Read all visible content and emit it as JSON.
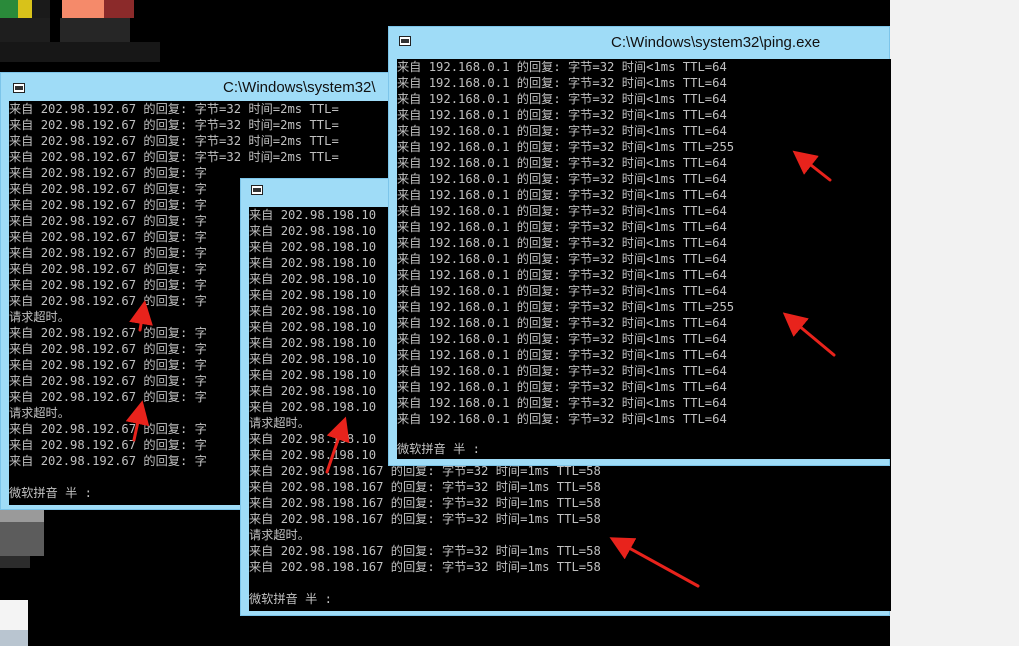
{
  "windows": {
    "left": {
      "title": "C:\\Windows\\system32\\",
      "lines": [
        "来自 202.98.192.67 的回复: 字节=32 时间=2ms TTL=",
        "来自 202.98.192.67 的回复: 字节=32 时间=2ms TTL=",
        "来自 202.98.192.67 的回复: 字节=32 时间=2ms TTL=",
        "来自 202.98.192.67 的回复: 字节=32 时间=2ms TTL=",
        "来自 202.98.192.67 的回复: 字",
        "来自 202.98.192.67 的回复: 字",
        "来自 202.98.192.67 的回复: 字",
        "来自 202.98.192.67 的回复: 字",
        "来自 202.98.192.67 的回复: 字",
        "来自 202.98.192.67 的回复: 字",
        "来自 202.98.192.67 的回复: 字",
        "来自 202.98.192.67 的回复: 字",
        "来自 202.98.192.67 的回复: 字",
        "请求超时。",
        "来自 202.98.192.67 的回复: 字",
        "来自 202.98.192.67 的回复: 字",
        "来自 202.98.192.67 的回复: 字",
        "来自 202.98.192.67 的回复: 字",
        "来自 202.98.192.67 的回复: 字",
        "请求超时。",
        "来自 202.98.192.67 的回复: 字",
        "来自 202.98.192.67 的回复: 字",
        "来自 202.98.192.67 的回复: 字"
      ],
      "ime": "微软拼音 半 :"
    },
    "middle": {
      "lines": [
        "来自 202.98.198.10",
        "来自 202.98.198.10",
        "来自 202.98.198.10",
        "来自 202.98.198.10",
        "来自 202.98.198.10",
        "来自 202.98.198.10",
        "来自 202.98.198.10",
        "来自 202.98.198.10",
        "来自 202.98.198.10",
        "来自 202.98.198.10",
        "来自 202.98.198.10",
        "来自 202.98.198.10",
        "来自 202.98.198.10",
        "请求超时。",
        "来自 202.98.198.10",
        "来自 202.98.198.10",
        "来自 202.98.198.167 的回复: 字节=32 时间=1ms TTL=58",
        "来自 202.98.198.167 的回复: 字节=32 时间=1ms TTL=58",
        "来自 202.98.198.167 的回复: 字节=32 时间=1ms TTL=58",
        "来自 202.98.198.167 的回复: 字节=32 时间=1ms TTL=58",
        "请求超时。",
        "来自 202.98.198.167 的回复: 字节=32 时间=1ms TTL=58",
        "来自 202.98.198.167 的回复: 字节=32 时间=1ms TTL=58"
      ],
      "ime": "微软拼音 半 :"
    },
    "right": {
      "title": "C:\\Windows\\system32\\ping.exe",
      "lines": [
        "来自 192.168.0.1 的回复: 字节=32 时间<1ms TTL=64",
        "来自 192.168.0.1 的回复: 字节=32 时间<1ms TTL=64",
        "来自 192.168.0.1 的回复: 字节=32 时间<1ms TTL=64",
        "来自 192.168.0.1 的回复: 字节=32 时间<1ms TTL=64",
        "来自 192.168.0.1 的回复: 字节=32 时间<1ms TTL=64",
        "来自 192.168.0.1 的回复: 字节=32 时间<1ms TTL=255",
        "来自 192.168.0.1 的回复: 字节=32 时间<1ms TTL=64",
        "来自 192.168.0.1 的回复: 字节=32 时间<1ms TTL=64",
        "来自 192.168.0.1 的回复: 字节=32 时间<1ms TTL=64",
        "来自 192.168.0.1 的回复: 字节=32 时间<1ms TTL=64",
        "来自 192.168.0.1 的回复: 字节=32 时间<1ms TTL=64",
        "来自 192.168.0.1 的回复: 字节=32 时间<1ms TTL=64",
        "来自 192.168.0.1 的回复: 字节=32 时间<1ms TTL=64",
        "来自 192.168.0.1 的回复: 字节=32 时间<1ms TTL=64",
        "来自 192.168.0.1 的回复: 字节=32 时间<1ms TTL=64",
        "来自 192.168.0.1 的回复: 字节=32 时间<1ms TTL=255",
        "来自 192.168.0.1 的回复: 字节=32 时间<1ms TTL=64",
        "来自 192.168.0.1 的回复: 字节=32 时间<1ms TTL=64",
        "来自 192.168.0.1 的回复: 字节=32 时间<1ms TTL=64",
        "来自 192.168.0.1 的回复: 字节=32 时间<1ms TTL=64",
        "来自 192.168.0.1 的回复: 字节=32 时间<1ms TTL=64",
        "来自 192.168.0.1 的回复: 字节=32 时间<1ms TTL=64",
        "来自 192.168.0.1 的回复: 字节=32 时间<1ms TTL=64"
      ],
      "ime": "微软拼音 半 :"
    }
  },
  "colors": {
    "console_bg": "#000000",
    "console_text": "#c0c0c0",
    "titlebar": "#9fdcf7",
    "annotation_arrow": "#e8231c"
  }
}
